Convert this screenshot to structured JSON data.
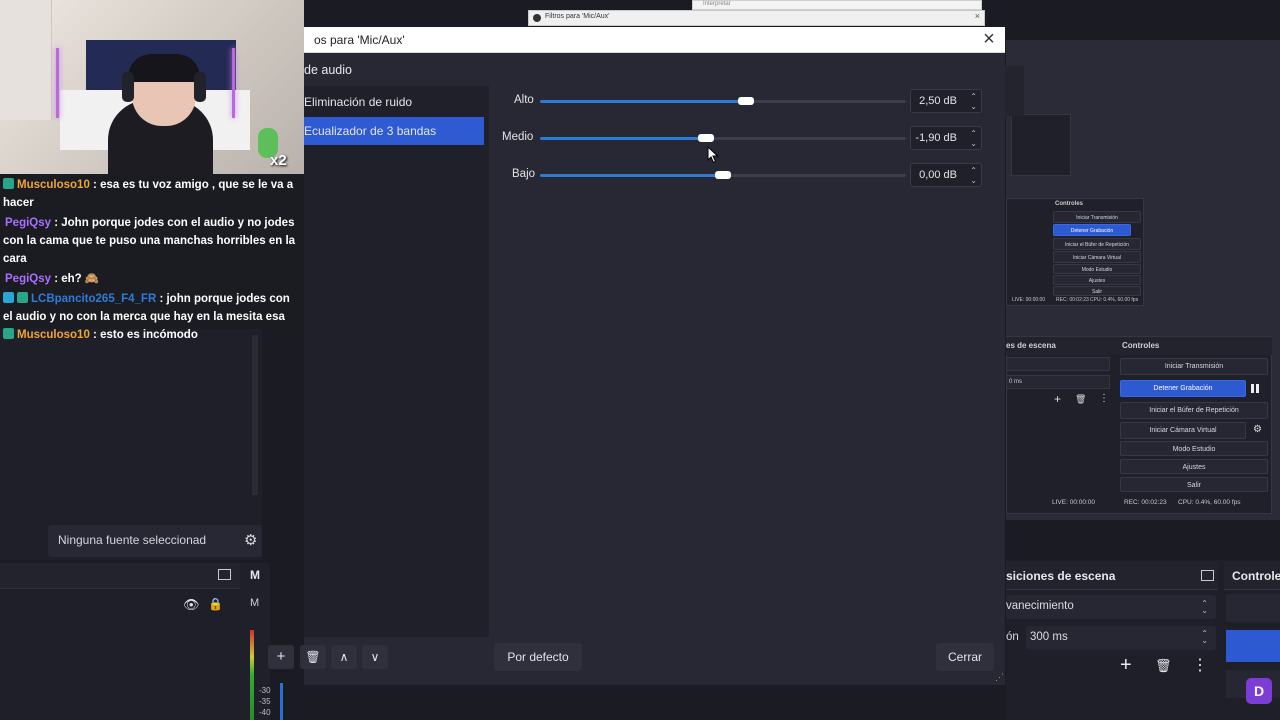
{
  "background": {
    "source_placeholder": "Ninguna fuente seleccionad",
    "mixer_scale": [
      "-30",
      "-35",
      "-40"
    ],
    "mixer_header_partial": "M",
    "mixer_row_partial": "M",
    "right_docks": {
      "transitions_title": "siciones de escena",
      "transition_value": "vanecimiento",
      "duration_label": "ón",
      "duration_value": "300 ms",
      "controls_title": "Controle"
    },
    "nested_preview": {
      "transitions_title": "es de escena",
      "controls_title": "Controles",
      "duration_value": "0 ms",
      "controls": [
        "Iniciar Transmisión",
        "Detener Grabación",
        "Iniciar el Búfer de Repetición",
        "Iniciar Cámara Virtual",
        "Modo Estudio",
        "Ajustes",
        "Salir"
      ],
      "status": {
        "live": "LIVE: 00:00:00",
        "rec": "REC: 00:02:23",
        "cpu": "CPU: 0.4%, 60.00 fps"
      }
    },
    "nested_preview_small": {
      "controls_title": "Controles",
      "controls": [
        "Iniciar Transmisión",
        "Detener Grabación",
        "Iniciar el Búfer de Repetición",
        "Iniciar Cámara Virtual",
        "Modo Estudio",
        "Ajustes",
        "Salir"
      ],
      "status": {
        "live": "LIVE: 00:00:00",
        "rec": "REC: 00:02:23",
        "cpu": "CPU: 0.4%, 60.00 fps"
      }
    }
  },
  "chat": [
    {
      "user": "Musculoso10",
      "color": "#f0a43a",
      "badge_color": "#2aa58a",
      "text": " : esa es tu voz amigo , que se le va a hacer"
    },
    {
      "user": "PegiQsy",
      "color": "#a970ff",
      "badge_color": "",
      "text": " : John porque jodes con el audio y no jodes con la cama que te puso una manchas horribles en la cara"
    },
    {
      "user": "PegiQsy",
      "color": "#a970ff",
      "badge_color": "",
      "text": " : eh? 🙈"
    },
    {
      "user": "LCBpancito265_F4_FR",
      "color": "#2e7bd8",
      "badge_color": "#2aa5d8",
      "text": " : john porque jodes con el audio y no con la merca que hay en la mesita esa"
    },
    {
      "user": "Musculoso10",
      "color": "#f0a43a",
      "badge_color": "#2aa58a",
      "text": " : esto es incómodo"
    }
  ],
  "webcam": {
    "badge": "x2"
  },
  "dialog": {
    "top_strip_title": "Filtros para 'Mic/Aux'",
    "top_strip2_title": "Interpretar",
    "title": "os para 'Mic/Aux'",
    "heading": "de audio",
    "filters": [
      {
        "label": "Eliminación de ruido",
        "selected": false
      },
      {
        "label": "Ecualizador de 3 bandas",
        "selected": true
      }
    ],
    "eq": {
      "min_db": -20,
      "max_db": 20,
      "bands": [
        {
          "label": "Alto",
          "value_db": 2.5,
          "display": "2,50 dB"
        },
        {
          "label": "Medio",
          "value_db": -1.9,
          "display": "-1,90 dB"
        },
        {
          "label": "Bajo",
          "value_db": 0.0,
          "display": "0,00 dB"
        }
      ]
    },
    "buttons": {
      "defaults": "Por defecto",
      "close": "Cerrar"
    }
  },
  "icons": {
    "add": "+",
    "delete": "🗑",
    "up": "∧",
    "down": "∨",
    "close": "×",
    "gear": "⚙",
    "eye": "👁",
    "lock": "🔒",
    "menu": "⋮",
    "spin_up": "⌃",
    "spin_down": "⌄"
  }
}
